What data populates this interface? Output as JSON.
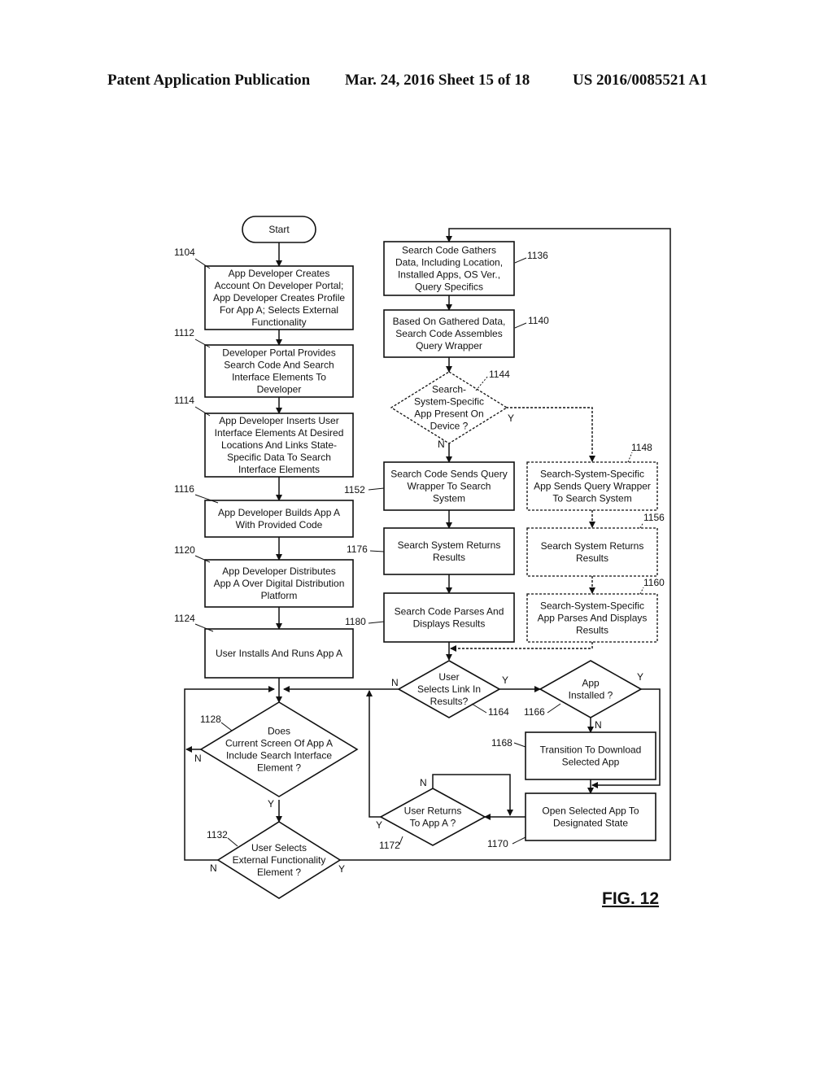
{
  "header": {
    "publication": "Patent Application Publication",
    "date_sheet": "Mar. 24, 2016  Sheet 15 of 18",
    "number": "US 2016/0085521 A1"
  },
  "figure_label": "FIG. 12",
  "nodes": {
    "start": {
      "lines": [
        "Start"
      ]
    },
    "n1104": {
      "ref": "1104",
      "lines": [
        "App Developer Creates",
        "Account On Developer Portal;",
        "App Developer Creates Profile",
        "For App A; Selects External",
        "Functionality"
      ]
    },
    "n1112": {
      "ref": "1112",
      "lines": [
        "Developer Portal Provides",
        "Search Code And Search",
        "Interface Elements To",
        "Developer"
      ]
    },
    "n1114": {
      "ref": "1114",
      "lines": [
        "App Developer Inserts User",
        "Interface Elements At Desired",
        "Locations And Links State-",
        "Specific Data To Search",
        "Interface Elements"
      ]
    },
    "n1116": {
      "ref": "1116",
      "lines": [
        "App Developer Builds App A",
        "With Provided Code"
      ]
    },
    "n1120": {
      "ref": "1120",
      "lines": [
        "App Developer Distributes",
        "App A Over Digital Distribution",
        "Platform"
      ]
    },
    "n1124": {
      "ref": "1124",
      "lines": [
        "User Installs And Runs App A"
      ]
    },
    "n1128": {
      "ref": "1128",
      "lines": [
        "Does",
        "Current Screen Of App A",
        "Include Search Interface",
        "Element ?"
      ]
    },
    "n1132": {
      "ref": "1132",
      "lines": [
        "User Selects",
        "External Functionality",
        "Element ?"
      ]
    },
    "n1136": {
      "ref": "1136",
      "lines": [
        "Search Code Gathers",
        "Data, Including Location,",
        "Installed Apps, OS Ver.,",
        "Query Specifics"
      ]
    },
    "n1140": {
      "ref": "1140",
      "lines": [
        "Based On Gathered Data,",
        "Search Code Assembles",
        "Query Wrapper"
      ]
    },
    "n1144": {
      "ref": "1144",
      "lines": [
        "Search-",
        "System-Specific",
        "App Present On",
        "Device ?"
      ]
    },
    "n1148": {
      "ref": "1148",
      "lines": [
        "Search-System-Specific",
        "App Sends Query Wrapper",
        "To Search System"
      ]
    },
    "n1152": {
      "ref": "1152",
      "lines": [
        "Search Code Sends Query",
        "Wrapper To Search",
        "System"
      ]
    },
    "n1156": {
      "ref": "1156",
      "lines": [
        "Search System Returns",
        "Results"
      ]
    },
    "n1160": {
      "ref": "1160",
      "lines": [
        "Search-System-Specific",
        "App Parses And Displays",
        "Results"
      ]
    },
    "n1164": {
      "ref": "1164",
      "lines": [
        "User",
        "Selects Link In",
        "Results?"
      ]
    },
    "n1166": {
      "ref": "1166",
      "lines": [
        "App",
        "Installed ?"
      ]
    },
    "n1168": {
      "ref": "1168",
      "lines": [
        "Transition To Download",
        "Selected App"
      ]
    },
    "n1170": {
      "ref": "1170",
      "lines": [
        "Open Selected App To",
        "Designated State"
      ]
    },
    "n1172": {
      "ref": "1172",
      "lines": [
        "User Returns",
        "To App A ?"
      ]
    },
    "n1176": {
      "ref": "1176",
      "lines": [
        "Search System Returns",
        "Results"
      ]
    },
    "n1180": {
      "ref": "1180",
      "lines": [
        "Search Code Parses And",
        "Displays Results"
      ]
    }
  },
  "branch_labels": {
    "yes": "Y",
    "no": "N"
  }
}
